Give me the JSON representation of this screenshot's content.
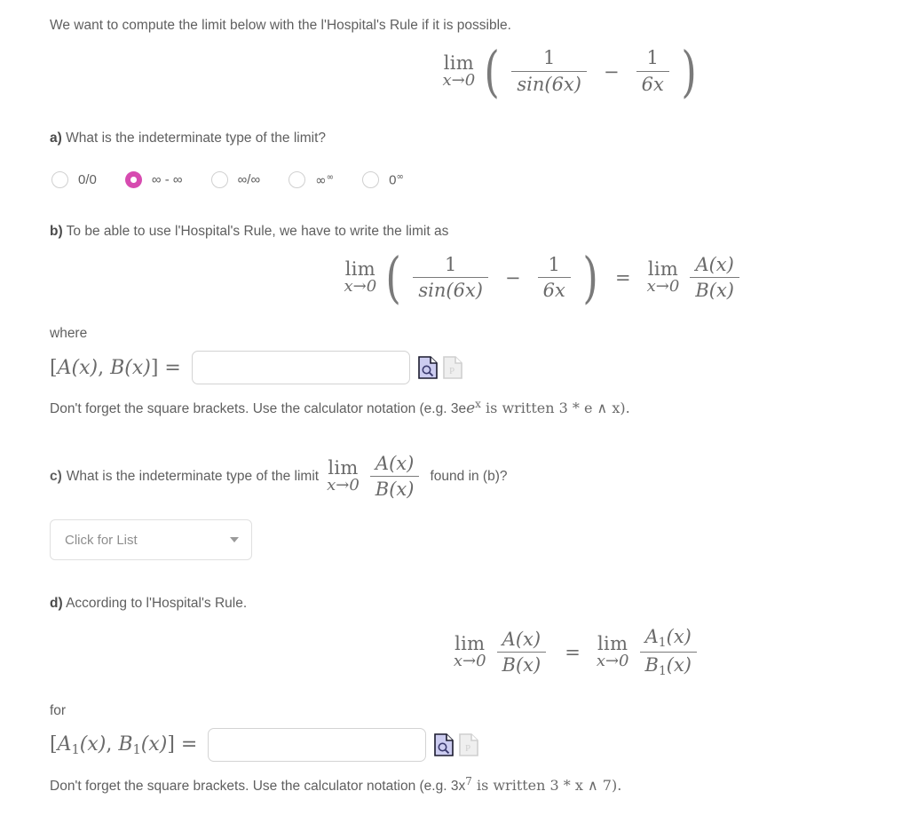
{
  "intro": {
    "text": "We want to compute the limit below with the l'Hospital's Rule if it is possible."
  },
  "main_limit": {
    "lim": "lim",
    "approach": "x→0",
    "open_paren": "(",
    "frac1_num": "1",
    "frac1_den": "sin(6x)",
    "minus": "−",
    "frac2_num": "1",
    "frac2_den": "6x",
    "close_paren": ")"
  },
  "part_a": {
    "label": "a)",
    "question": "What is the indeterminate type of the limit?",
    "options": [
      {
        "label": "0/0",
        "kind": "plain",
        "selected": false
      },
      {
        "label": "∞ - ∞",
        "kind": "plain",
        "selected": true
      },
      {
        "label": "∞/∞",
        "kind": "plain",
        "selected": false
      },
      {
        "label": "∞",
        "sup": "∞",
        "kind": "sup",
        "selected": false
      },
      {
        "label": "0",
        "sup": "∞",
        "kind": "sup",
        "selected": false
      }
    ],
    "accent_color": "#d74bb0"
  },
  "part_b": {
    "label": "b)",
    "question": "To be able to use l'Hospital's Rule, we have to write the limit as",
    "equation": {
      "lim": "lim",
      "approach": "x→0",
      "open_paren": "(",
      "frac1_num": "1",
      "frac1_den": "sin(6x)",
      "minus": "−",
      "frac2_num": "1",
      "frac2_den": "6x",
      "close_paren": ")",
      "equals": "=",
      "lim2": "lim",
      "approach2": "x→0",
      "rhs_num": "A(x)",
      "rhs_den": "B(x)"
    },
    "where_label": "where",
    "answer_lhs_open": "[",
    "answer_lhs_A": "A(x)",
    "answer_lhs_comma": ",",
    "answer_lhs_B": "B(x)",
    "answer_lhs_close": "] =",
    "answer_value": "",
    "answer_placeholder": "",
    "hint": "Don't forget the square brackets. Use the calculator notation (e.g. 3e",
    "hint_sup": "x",
    "hint_tail": " is written 3 * e ∧ x)."
  },
  "part_c": {
    "label": "c)",
    "question_pre": "What is the indeterminate type of the limit",
    "lim": "lim",
    "approach": "x→0",
    "frac_num": "A(x)",
    "frac_den": "B(x)",
    "question_post": "found in (b)?",
    "dropdown": {
      "value": "Click for List",
      "caret": "chevron-down"
    }
  },
  "part_d": {
    "label": "d)",
    "question": "According to l'Hospital's Rule.",
    "equation": {
      "lim": "lim",
      "approach": "x→0",
      "lhs_num": "A(x)",
      "lhs_den": "B(x)",
      "equals": "=",
      "lim2": "lim",
      "approach2": "x→0",
      "rhs_num_A": "A",
      "rhs_num_sub": "1",
      "rhs_num_tail": "(x)",
      "rhs_den_B": "B",
      "rhs_den_sub": "1",
      "rhs_den_tail": "(x)"
    },
    "for_label": "for",
    "answer_lhs_open": "[",
    "answer_lhs_A": "A",
    "answer_lhs_A_sub": "1",
    "answer_lhs_A_tail": "(x)",
    "answer_lhs_comma": ",",
    "answer_lhs_B": "B",
    "answer_lhs_B_sub": "1",
    "answer_lhs_B_tail": "(x)",
    "answer_lhs_close": "] =",
    "answer_value": "",
    "answer_placeholder": "",
    "hint": "Don't forget the square brackets. Use the calculator notation (e.g. 3x",
    "hint_sup": "7",
    "hint_tail": " is written 3 * x ∧ 7)."
  },
  "icons": {
    "preview_icon_name": "preview-document-icon",
    "preview_icon_fill": "#ccccf0",
    "print_icon_name": "print-document-icon",
    "print_icon_fill": "#e8e8e8"
  }
}
